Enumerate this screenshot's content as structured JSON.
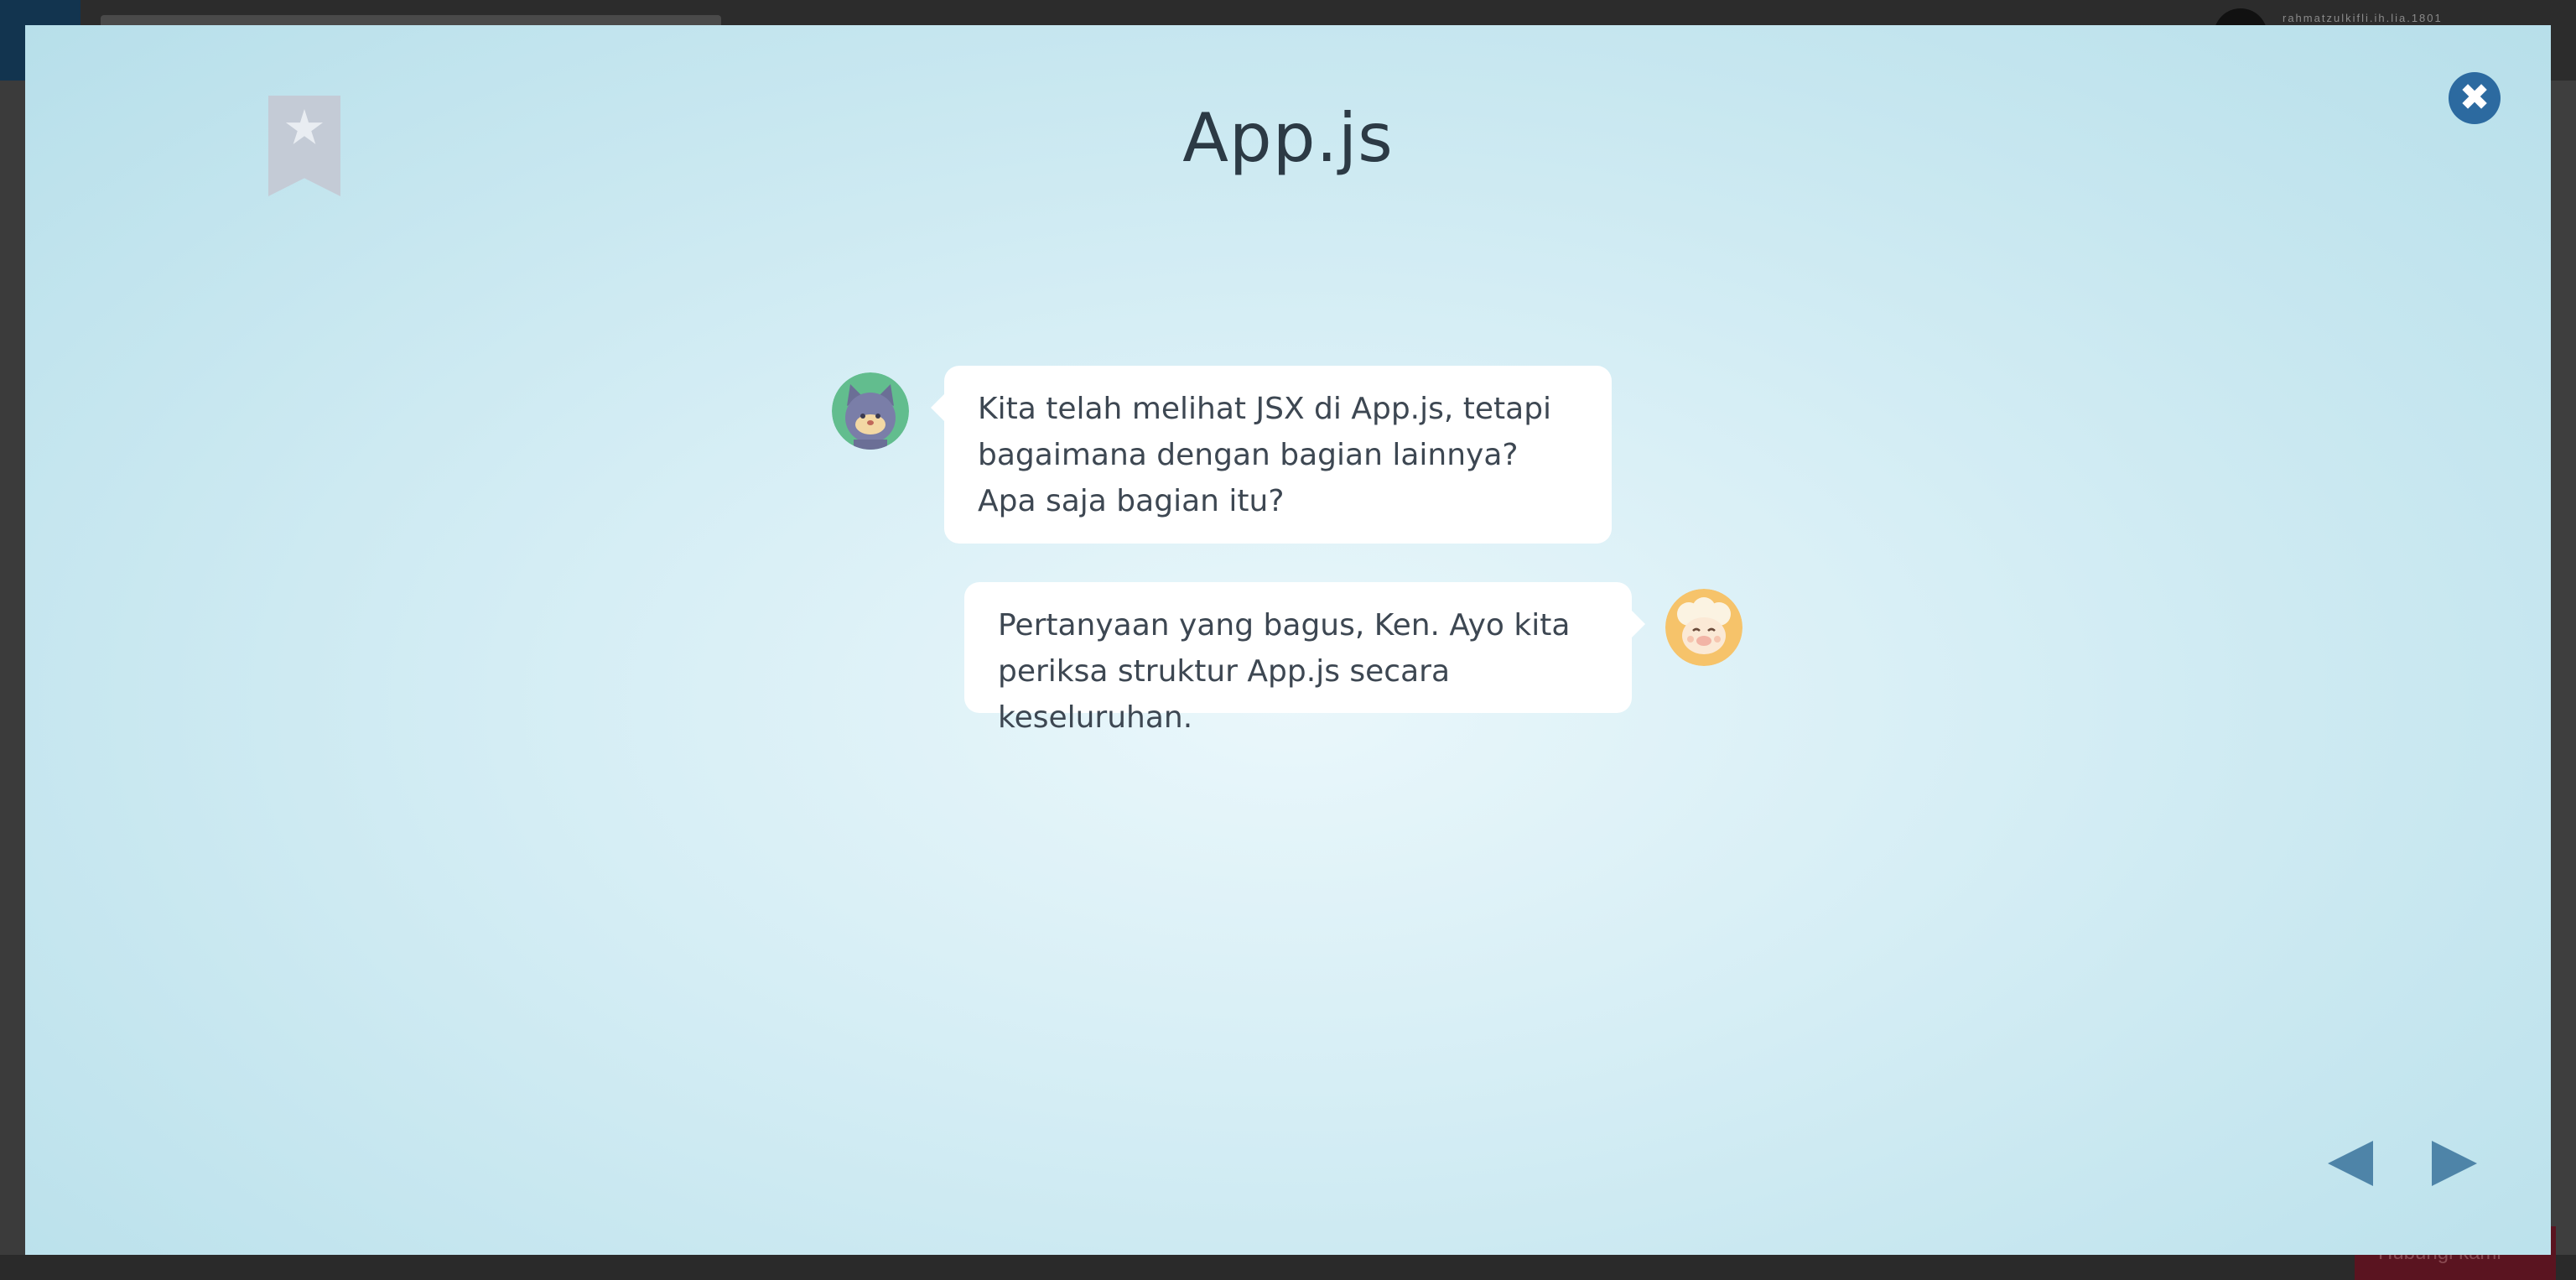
{
  "background": {
    "username": "rahmatzulkifli.ih.lia.1801",
    "cta_label": "Hubungi kami"
  },
  "modal": {
    "title": "App.js",
    "close_icon": "✖",
    "bookmark_icon": "star-bookmark-icon",
    "messages": [
      {
        "speaker": "ken",
        "side": "left",
        "text": "Kita telah melihat JSX di App.js, tetapi bagaimana dengan bagian lainnya? Apa saja bagian itu?"
      },
      {
        "speaker": "sheep",
        "side": "right",
        "text": "Pertanyaan yang bagus, Ken. Ayo kita periksa struktur App.js secara keseluruhan."
      }
    ],
    "nav": {
      "prev_icon": "triangle-left-icon",
      "next_icon": "triangle-right-icon"
    }
  },
  "colors": {
    "accent": "#2c6aa0",
    "nav": "#4e84a8",
    "bubble": "#ffffff",
    "text": "#3d4752"
  }
}
